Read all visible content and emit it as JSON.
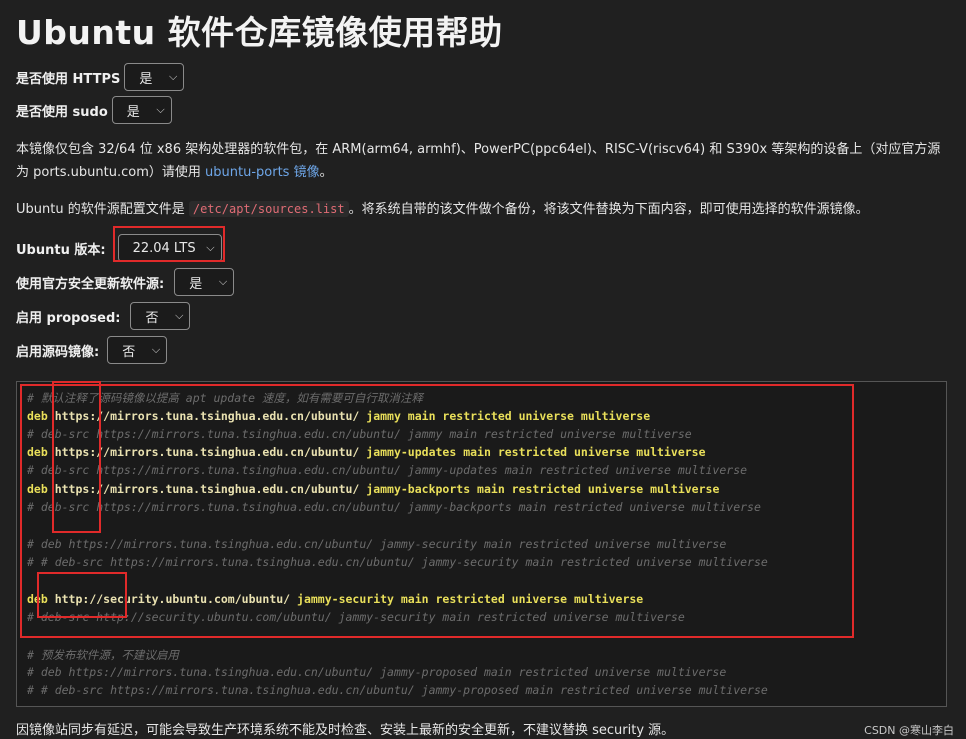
{
  "page": {
    "title": "Ubuntu 软件仓库镜像使用帮助"
  },
  "options": {
    "https": {
      "label": "是否使用 HTTPS",
      "value": "是"
    },
    "sudo": {
      "label": "是否使用 sudo",
      "value": "是"
    }
  },
  "intro": {
    "text1": "本镜像仅包含 32/64 位 x86 架构处理器的软件包，在 ARM(arm64, armhf)、PowerPC(ppc64el)、RISC-V(riscv64) 和 S390x 等架构的设备上（对应官方源为 ports.ubuntu.com）请使用 ",
    "link": "ubuntu-ports 镜像",
    "text1_end": "。"
  },
  "config": {
    "text_before": "Ubuntu 的软件源配置文件是",
    "file": "/etc/apt/sources.list",
    "text_after": "。将系统自带的该文件做个备份，将该文件替换为下面内容，即可使用选择的软件源镜像。"
  },
  "settings": {
    "version": {
      "label": "Ubuntu 版本:",
      "value": "22.04 LTS"
    },
    "security": {
      "label": "使用官方安全更新软件源:",
      "value": "是"
    },
    "proposed": {
      "label": "启用 proposed:",
      "value": "否"
    },
    "source": {
      "label": "启用源码镜像:",
      "value": "否"
    }
  },
  "code": {
    "l01": "# 默认注释了源码镜像以提高 apt update 速度，如有需要可自行取消注释",
    "l02_kw": "deb",
    "l02_url": " https://mirrors.tuna.tsinghua.edu.cn/ubuntu/",
    "l02_rest": " jammy main restricted universe multiverse",
    "l03": "# deb-src https://mirrors.tuna.tsinghua.edu.cn/ubuntu/ jammy main restricted universe multiverse",
    "l04_kw": "deb",
    "l04_url": " https://mirrors.tuna.tsinghua.edu.cn/ubuntu/",
    "l04_rest": " jammy-updates main restricted universe multiverse",
    "l05": "# deb-src https://mirrors.tuna.tsinghua.edu.cn/ubuntu/ jammy-updates main restricted universe multiverse",
    "l06_kw": "deb",
    "l06_url": " https://mirrors.tuna.tsinghua.edu.cn/ubuntu/",
    "l06_rest": " jammy-backports main restricted universe multiverse",
    "l07": "# deb-src https://mirrors.tuna.tsinghua.edu.cn/ubuntu/ jammy-backports main restricted universe multiverse",
    "l08": "# deb https://mirrors.tuna.tsinghua.edu.cn/ubuntu/ jammy-security main restricted universe multiverse",
    "l09": "# # deb-src https://mirrors.tuna.tsinghua.edu.cn/ubuntu/ jammy-security main restricted universe multiverse",
    "l10_kw": "deb",
    "l10_url": " http://security.ubuntu.com/ubuntu/",
    "l10_rest": " jammy-security main restricted universe multiverse",
    "l11": "# deb-src http://security.ubuntu.com/ubuntu/ jammy-security main restricted universe multiverse",
    "l12": "# 预发布软件源，不建议启用",
    "l13": "# deb https://mirrors.tuna.tsinghua.edu.cn/ubuntu/ jammy-proposed main restricted universe multiverse",
    "l14": "# # deb-src https://mirrors.tuna.tsinghua.edu.cn/ubuntu/ jammy-proposed main restricted universe multiverse"
  },
  "footer": {
    "text": "因镜像站同步有延迟，可能会导致生产环境系统不能及时检查、安装上最新的安全更新，不建议替换 security 源。",
    "credit": "CSDN @寒山李白"
  },
  "colors": {
    "background": "#202020",
    "link": "#6ea6e8",
    "keyword": "#e9df5a",
    "highlight_box": "#e02a2a"
  }
}
